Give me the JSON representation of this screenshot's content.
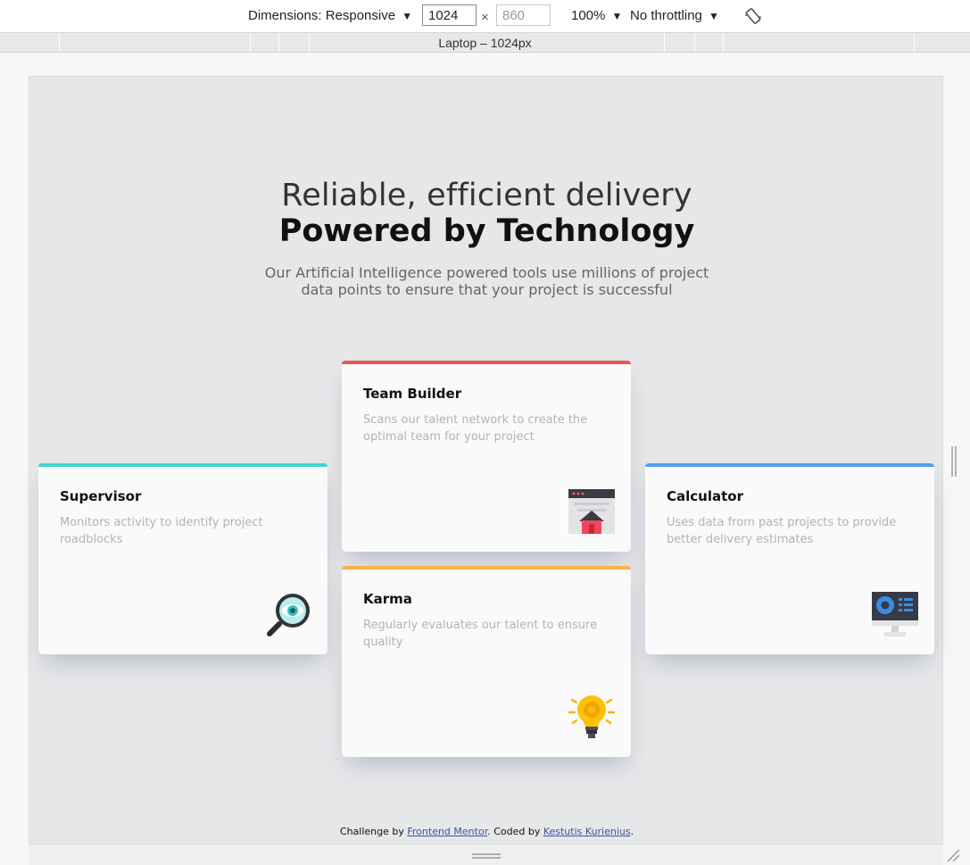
{
  "toolbar": {
    "dimensions_label": "Dimensions: Responsive",
    "width_value": "1024",
    "times": "×",
    "height_placeholder": "860",
    "zoom": "100%",
    "throttling": "No throttling"
  },
  "media_bar": {
    "label": "Laptop – 1024px"
  },
  "hero": {
    "line1": "Reliable, efficient delivery",
    "line2": "Powered by Technology",
    "description": "Our Artificial Intelligence powered tools use millions of project data points to ensure that your project is successful"
  },
  "cards": {
    "supervisor": {
      "title": "Supervisor",
      "desc": "Monitors activity to identify project roadblocks",
      "color": "#44d3d2",
      "icon": "magnifier-eye-icon"
    },
    "team_builder": {
      "title": "Team Builder",
      "desc": "Scans our talent network to create the optimal team for your project",
      "color": "#ea5454",
      "icon": "browser-home-icon"
    },
    "karma": {
      "title": "Karma",
      "desc": "Regularly evaluates our talent to ensure quality",
      "color": "#fcaf4a",
      "icon": "lightbulb-icon"
    },
    "calculator": {
      "title": "Calculator",
      "desc": "Uses data from past projects to provide better delivery estimates",
      "color": "#549ef2",
      "icon": "monitor-chart-icon"
    }
  },
  "footer": {
    "prefix": "Challenge by ",
    "link1": "Frontend Mentor",
    "middle": ". Coded by ",
    "link2": "Kestutis Kurienius",
    "suffix": "."
  }
}
